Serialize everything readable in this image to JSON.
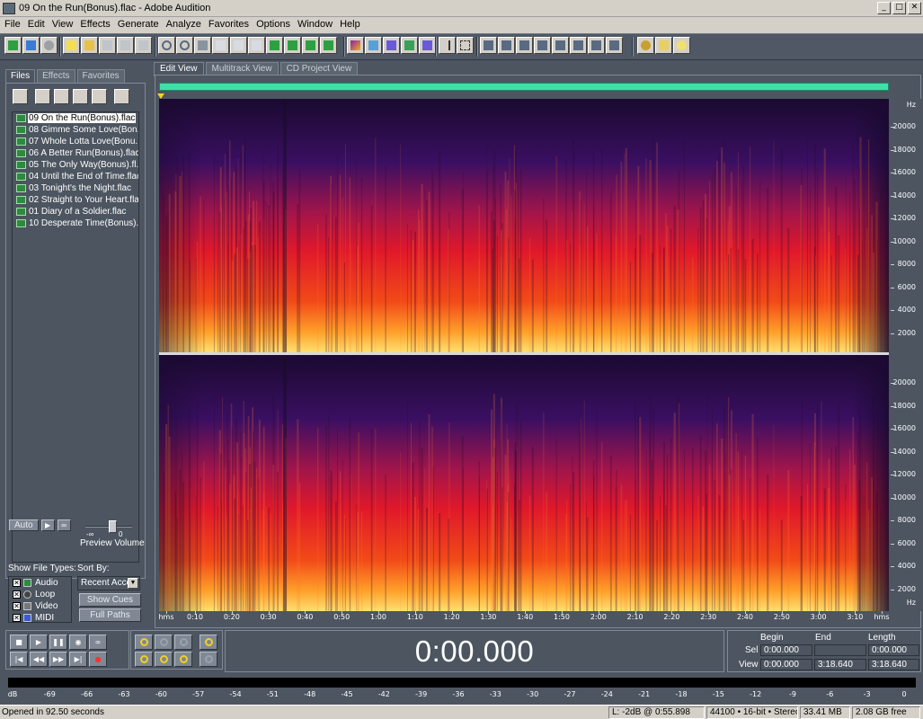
{
  "window": {
    "title": "09 On the Run(Bonus).flac - Adobe Audition",
    "buttons": [
      "_",
      "□",
      "✕"
    ]
  },
  "menu": [
    "File",
    "Edit",
    "View",
    "Effects",
    "Generate",
    "Analyze",
    "Favorites",
    "Options",
    "Window",
    "Help"
  ],
  "left_panel": {
    "tabs": [
      "Files",
      "Effects",
      "Favorites"
    ],
    "files": [
      "09 On the Run(Bonus).flac",
      "08 Gimme Some Love(Bon...",
      "07 Whole Lotta Love(Bonu...",
      "06 A Better Run(Bonus).flac",
      "05 The Only Way(Bonus).fl...",
      "04 Until the End of Time.flac",
      "03 Tonight's the Night.flac",
      "02 Straight to Your Heart.flac",
      "01 Diary of a Soldier.flac",
      "10 Desperate Time(Bonus)..."
    ],
    "auto_label": "Auto",
    "preview_volume_label": "Preview Volume",
    "slider_minus": "-∞",
    "slider_zero": "0",
    "preview_volume_level": 0.6,
    "show_file_types_label": "Show File Types:",
    "file_types": [
      {
        "label": "Audio",
        "checked": true
      },
      {
        "label": "Loop",
        "checked": true
      },
      {
        "label": "Video",
        "checked": true
      },
      {
        "label": "MIDI",
        "checked": true
      }
    ],
    "sort_by_label": "Sort By:",
    "sort_by_value": "Recent Acce",
    "show_cues_label": "Show Cues",
    "full_paths_label": "Full Paths"
  },
  "editor": {
    "tabs": [
      "Edit View",
      "Multitrack View",
      "CD Project View"
    ],
    "freq_labels": [
      "Hz",
      "20000",
      "18000",
      "16000",
      "14000",
      "12000",
      "10000",
      "8000",
      "6000",
      "4000",
      "2000",
      "Hz"
    ],
    "time_labels": [
      "hms",
      "0:10",
      "0:20",
      "0:30",
      "0:40",
      "0:50",
      "1:00",
      "1:10",
      "1:20",
      "1:30",
      "1:40",
      "1:50",
      "2:00",
      "2:10",
      "2:20",
      "2:30",
      "2:40",
      "2:50",
      "3:00",
      "3:10",
      "hms"
    ]
  },
  "time_display": "0:00.000",
  "selection": {
    "headers": [
      "Begin",
      "End",
      "Length"
    ],
    "sel_label": "Sel",
    "view_label": "View",
    "sel": [
      "0:00.000",
      "",
      "0:00.000"
    ],
    "view": [
      "0:00.000",
      "3:18.640",
      "3:18.640"
    ]
  },
  "level_meter": {
    "db_labels": [
      "dB",
      "-69",
      "-66",
      "-63",
      "-60",
      "-57",
      "-54",
      "-51",
      "-48",
      "-45",
      "-42",
      "-39",
      "-36",
      "-33",
      "-30",
      "-27",
      "-24",
      "-21",
      "-18",
      "-15",
      "-12",
      "-9",
      "-6",
      "-3",
      "0"
    ]
  },
  "status": {
    "left": "Opened in 92.50 seconds",
    "cursor": "L: -2dB @   0:55.898",
    "format": "44100 • 16-bit • Stereo",
    "size": "33.41 MB",
    "free": "2.08 GB free"
  },
  "colors": {
    "overview": "#3fe0a6",
    "chrome": "#4c5560",
    "selected_marker": "#ffd21e"
  }
}
